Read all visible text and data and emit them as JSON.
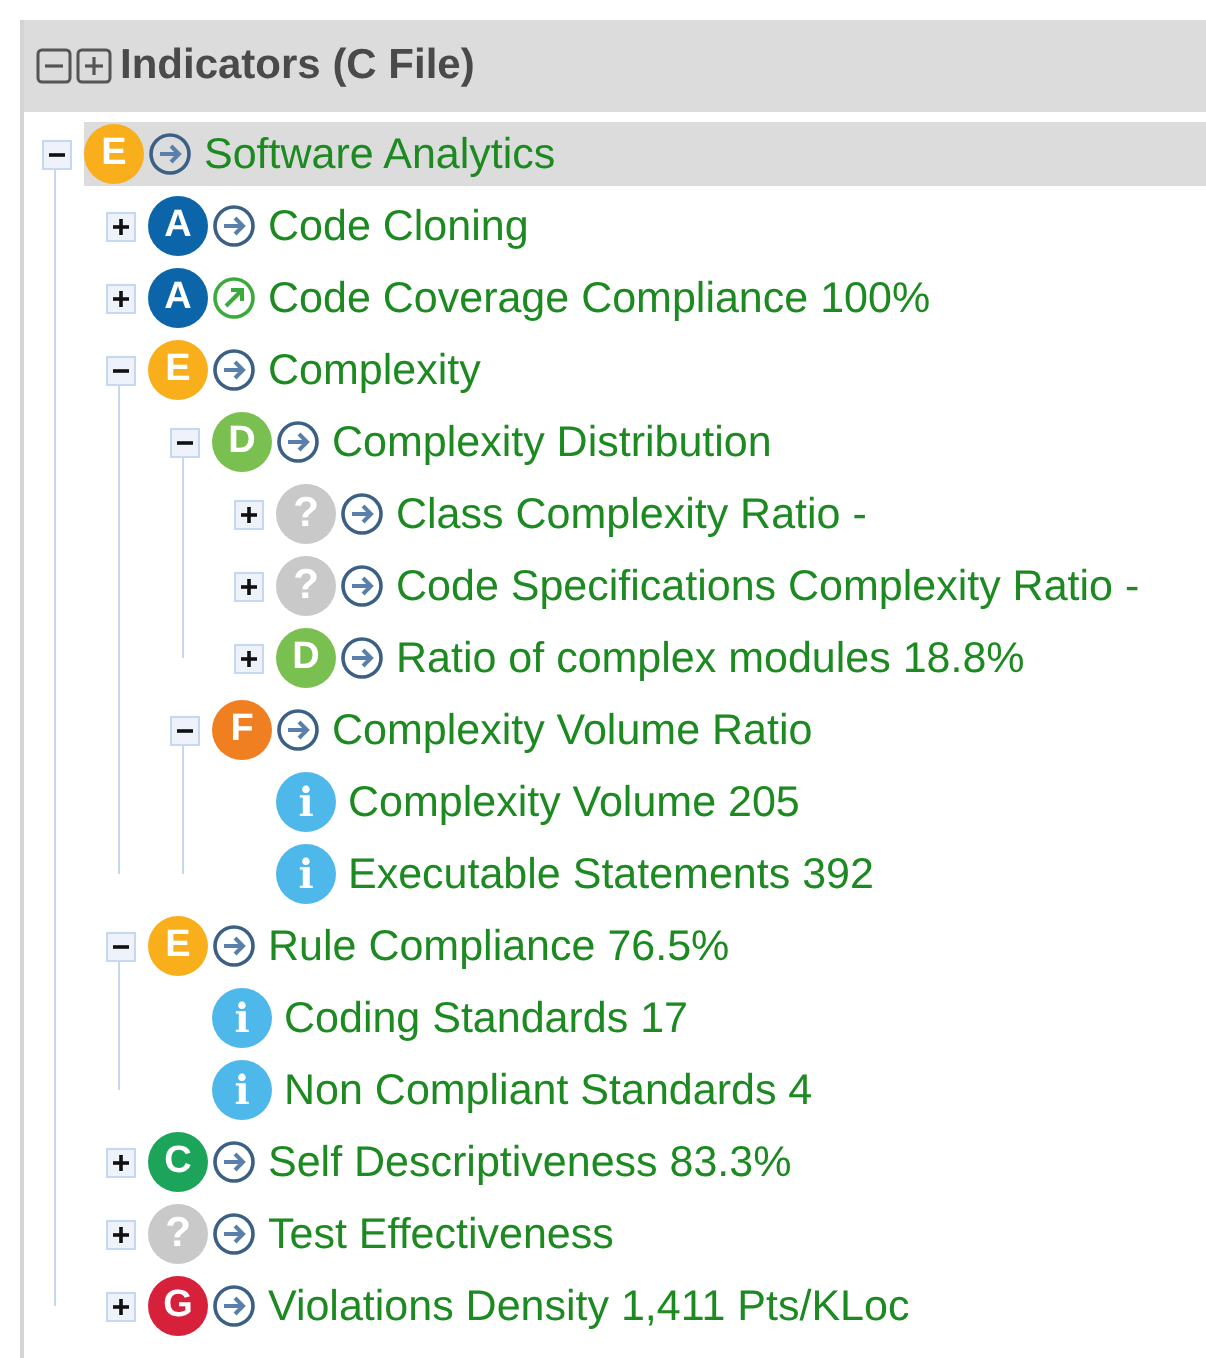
{
  "panel": {
    "title": "Indicators (C File)"
  },
  "tree": [
    {
      "label": "Software Analytics",
      "selected": true,
      "expanded": true,
      "badge": {
        "kind": "grade",
        "text": "E",
        "color": "#f9ae1b"
      },
      "trend": {
        "kind": "right"
      },
      "children": [
        {
          "label": "Code Cloning",
          "selected": false,
          "expanded": false,
          "badge": {
            "kind": "grade",
            "text": "A",
            "color": "#0b65a8"
          },
          "trend": {
            "kind": "right"
          }
        },
        {
          "label": "Code Coverage Compliance 100%",
          "selected": false,
          "expanded": false,
          "badge": {
            "kind": "grade",
            "text": "A",
            "color": "#0b65a8"
          },
          "trend": {
            "kind": "up"
          }
        },
        {
          "label": "Complexity",
          "selected": false,
          "expanded": true,
          "badge": {
            "kind": "grade",
            "text": "E",
            "color": "#f9ae1b"
          },
          "trend": {
            "kind": "right"
          },
          "children": [
            {
              "label": "Complexity Distribution",
              "selected": false,
              "expanded": true,
              "badge": {
                "kind": "grade",
                "text": "D",
                "color": "#7ac050"
              },
              "trend": {
                "kind": "right"
              },
              "children": [
                {
                  "label": "Class Complexity Ratio -",
                  "selected": false,
                  "expanded": false,
                  "badge": {
                    "kind": "unknown",
                    "text": "?",
                    "color": "#c9c9c9"
                  },
                  "trend": {
                    "kind": "right"
                  }
                },
                {
                  "label": "Code Specifications Complexity Ratio -",
                  "selected": false,
                  "expanded": false,
                  "badge": {
                    "kind": "unknown",
                    "text": "?",
                    "color": "#c9c9c9"
                  },
                  "trend": {
                    "kind": "right"
                  }
                },
                {
                  "label": "Ratio of complex modules 18.8%",
                  "selected": false,
                  "expanded": false,
                  "badge": {
                    "kind": "grade",
                    "text": "D",
                    "color": "#7ac050"
                  },
                  "trend": {
                    "kind": "right"
                  }
                }
              ]
            },
            {
              "label": "Complexity Volume Ratio",
              "selected": false,
              "expanded": true,
              "badge": {
                "kind": "grade",
                "text": "F",
                "color": "#f07f22"
              },
              "trend": {
                "kind": "right"
              },
              "children": [
                {
                  "label": "Complexity Volume 205",
                  "selected": false,
                  "badge": {
                    "kind": "info",
                    "text": "i",
                    "color": "#4fb8ea"
                  }
                },
                {
                  "label": "Executable Statements 392",
                  "selected": false,
                  "badge": {
                    "kind": "info",
                    "text": "i",
                    "color": "#4fb8ea"
                  }
                }
              ]
            }
          ]
        },
        {
          "label": "Rule Compliance 76.5%",
          "selected": false,
          "expanded": true,
          "badge": {
            "kind": "grade",
            "text": "E",
            "color": "#f9ae1b"
          },
          "trend": {
            "kind": "right"
          },
          "children": [
            {
              "label": "Coding Standards 17",
              "selected": false,
              "badge": {
                "kind": "info",
                "text": "i",
                "color": "#4fb8ea"
              }
            },
            {
              "label": "Non Compliant Standards 4",
              "selected": false,
              "badge": {
                "kind": "info",
                "text": "i",
                "color": "#4fb8ea"
              }
            }
          ]
        },
        {
          "label": "Self Descriptiveness 83.3%",
          "selected": false,
          "expanded": false,
          "badge": {
            "kind": "grade",
            "text": "C",
            "color": "#1ca45a"
          },
          "trend": {
            "kind": "right"
          }
        },
        {
          "label": "Test Effectiveness",
          "selected": false,
          "expanded": false,
          "badge": {
            "kind": "unknown",
            "text": "?",
            "color": "#c9c9c9"
          },
          "trend": {
            "kind": "right"
          }
        },
        {
          "label": "Violations Density 1,411 Pts/KLoc",
          "selected": false,
          "expanded": false,
          "badge": {
            "kind": "grade",
            "text": "G",
            "color": "#d7213a"
          },
          "trend": {
            "kind": "right"
          }
        }
      ]
    }
  ]
}
